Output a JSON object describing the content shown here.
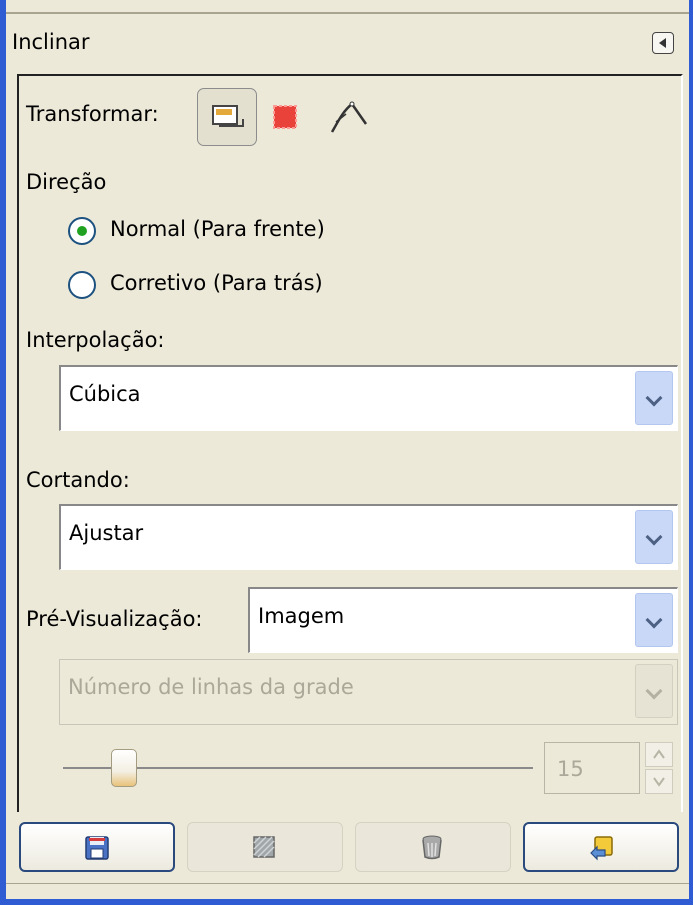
{
  "panel": {
    "title": "Inclinar"
  },
  "transform": {
    "label": "Transformar:",
    "options": [
      "layer",
      "selection",
      "path"
    ],
    "active": "layer"
  },
  "direction": {
    "label": "Direção",
    "options": [
      {
        "label": "Normal (Para frente)",
        "checked": true
      },
      {
        "label": "Corretivo (Para trás)",
        "checked": false
      }
    ]
  },
  "interpolation": {
    "label": "Interpolação:",
    "value": "Cúbica"
  },
  "clipping": {
    "label": "Cortando:",
    "value": "Ajustar"
  },
  "preview": {
    "label": "Pré-Visualização:",
    "value": "Imagem"
  },
  "grid": {
    "value": "Número de linhas da grade",
    "enabled": false,
    "count": "15"
  },
  "bottom_buttons": [
    {
      "name": "save-options",
      "icon": "floppy-disk-icon"
    },
    {
      "name": "restore-options",
      "icon": "restore-icon"
    },
    {
      "name": "delete-options",
      "icon": "trash-icon"
    },
    {
      "name": "reset-options",
      "icon": "reset-icon"
    }
  ],
  "colors": {
    "frame": "#2f5bd3",
    "background": "#ece9d8",
    "radio_dot": "#21a121",
    "combo_arrow": "#c9d8f7"
  }
}
